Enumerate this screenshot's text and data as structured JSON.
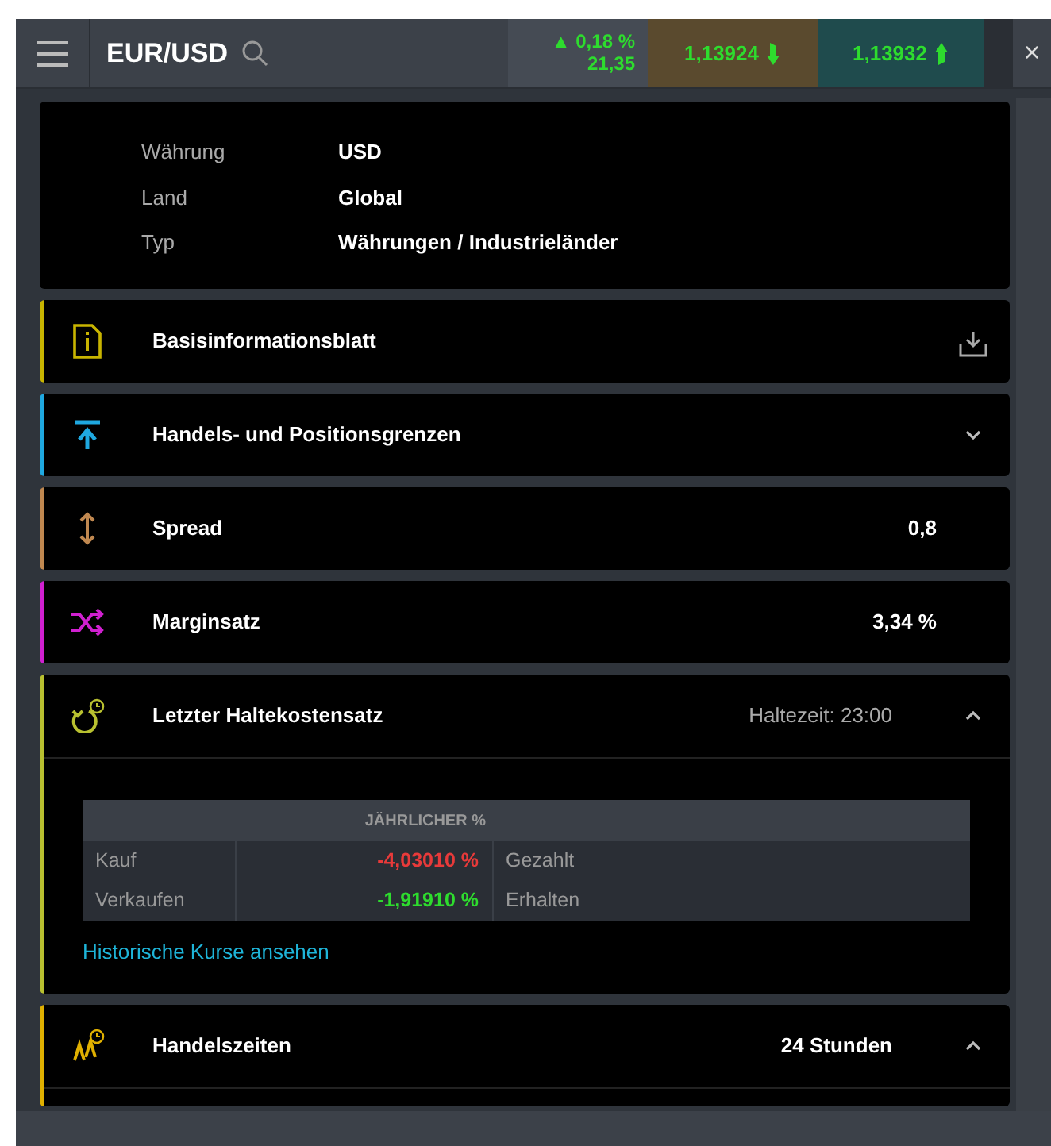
{
  "header": {
    "symbol": "EUR/USD",
    "change": "▲ 0,18 %",
    "change_points": "21,35",
    "sell": "1,13924",
    "buy": "1,13932",
    "close": "×"
  },
  "details": [
    {
      "label": "Währung",
      "value": "USD"
    },
    {
      "label": "Land",
      "value": "Global"
    },
    {
      "label": "Typ",
      "value": "Währungen / Industrieländer"
    }
  ],
  "sections": [
    {
      "title": "Basisinformationsblatt",
      "kind": "info",
      "color": "#c8b400",
      "download": true
    },
    {
      "title": "Handels- und Positionsgrenzen",
      "kind": "limit",
      "color": "#1fa8e0",
      "expanded": false
    },
    {
      "title": "Spread",
      "kind": "spread",
      "color": "#c08850",
      "value": "0,8",
      "muted": false
    },
    {
      "title": "Marginsatz",
      "kind": "shuffle",
      "color": "#d020d0",
      "value": "3,34 %",
      "muted": false
    },
    {
      "title": "Letzter Haltekostensatz",
      "kind": "cycle",
      "color": "#b8c030",
      "value": "Haltezeit: 23:00",
      "muted": true,
      "expanded": true,
      "table": {
        "heading": "JÄHRLICHER %",
        "rows": [
          {
            "label": "Kauf",
            "rate": "-4,03010 %",
            "color": "#e83a3a",
            "status": "Gezahlt"
          },
          {
            "label": "Verkaufen",
            "rate": "-1,91910 %",
            "color": "#2edc2e",
            "status": "Erhalten"
          }
        ]
      },
      "link": "Historische Kurse ansehen"
    },
    {
      "title": "Handelszeiten",
      "kind": "hours",
      "color": "#e0b000",
      "value": "24 Stunden",
      "muted": false,
      "expanded": true
    }
  ]
}
